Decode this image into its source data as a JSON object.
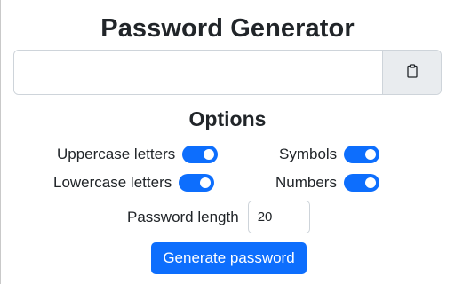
{
  "app": {
    "title": "Password Generator"
  },
  "password": {
    "value": "",
    "copy_icon": "clipboard-icon"
  },
  "options": {
    "title": "Options",
    "uppercase": {
      "label": "Uppercase letters",
      "checked": true
    },
    "lowercase": {
      "label": "Lowercase letters",
      "checked": true
    },
    "symbols": {
      "label": "Symbols",
      "checked": true
    },
    "numbers": {
      "label": "Numbers",
      "checked": true
    },
    "length": {
      "label": "Password length",
      "value": "20"
    }
  },
  "actions": {
    "generate_label": "Generate password"
  },
  "colors": {
    "accent": "#0d6efd",
    "addon_bg": "#e9ecef",
    "border": "#ced4da",
    "text": "#212529"
  }
}
